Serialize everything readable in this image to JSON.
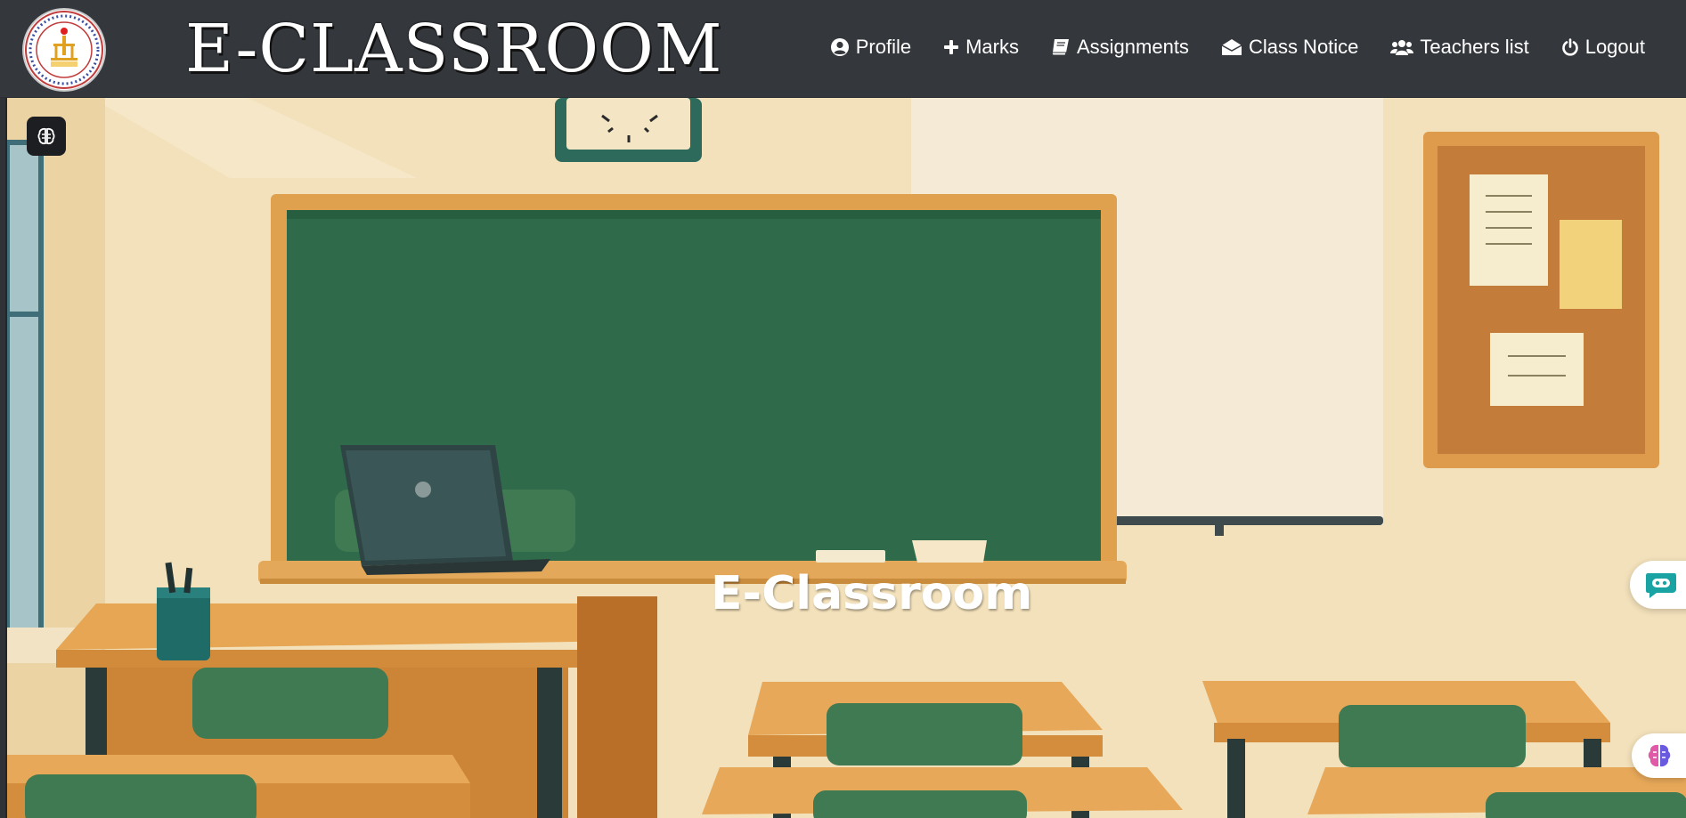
{
  "navbar": {
    "brand": "E-CLASSROOM",
    "logo_icon": "institute-emblem-icon",
    "items": [
      {
        "label": "Profile",
        "icon": "user-circle-icon"
      },
      {
        "label": "Marks",
        "icon": "plus-icon"
      },
      {
        "label": "Assignments",
        "icon": "book-icon"
      },
      {
        "label": "Class Notice",
        "icon": "envelope-open-icon"
      },
      {
        "label": "Teachers list",
        "icon": "users-icon"
      },
      {
        "label": "Logout",
        "icon": "power-icon"
      }
    ]
  },
  "hero": {
    "title": "E-Classroom",
    "background": "classroom-illustration"
  },
  "floating": {
    "brain_icon": "brain-icon",
    "chat_icon": "chatbot-icon",
    "ai_icon": "ai-brain-icon"
  },
  "colors": {
    "navbar_bg": "#34383d",
    "chalkboard": "#2f6b4a",
    "wall": "#f2dfb8",
    "accent_teal": "#1aa3a3"
  }
}
